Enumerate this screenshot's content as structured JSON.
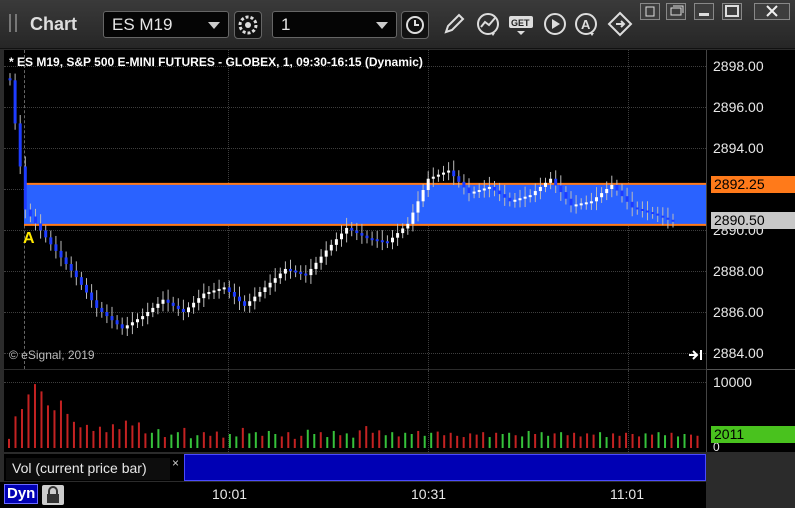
{
  "window": {
    "title": "Chart",
    "symbol": "ES M19",
    "interval": "1"
  },
  "chart": {
    "header": "* ES M19, S&P 500 E-MINI FUTURES - GLOBEX, 1, 09:30-16:15 (Dynamic)",
    "copyright": "© eSignal, 2019",
    "marker": "A",
    "price_ticks": [
      "2898.00",
      "2896.00",
      "2894.00",
      "2892.00",
      "2890.00",
      "2888.00",
      "2886.00",
      "2884.00"
    ],
    "upper_line": "2892.25",
    "last_price": "2890.50",
    "hidden_label": "2890.00",
    "volume_ticks": [
      "10000",
      "0"
    ],
    "volume_value": "2011",
    "volume_label": "Vol (current price bar)",
    "volume_close": "×",
    "time_labels": [
      "10:01",
      "10:31",
      "11:01"
    ],
    "layout_button": "Dyn",
    "colors": {
      "range": "#2a62ff",
      "orange_line": "#ff7a1a",
      "up_bar": "#ffffff",
      "down_bar": "#1e3cff",
      "vol_up": "#36c23b",
      "vol_down": "#c42222",
      "last_vol_tag": "#49c21e"
    }
  },
  "chart_data": {
    "type": "candlestick",
    "title": "* ES M19, S&P 500 E-MINI FUTURES - GLOBEX, 1, 09:30-16:15 (Dynamic)",
    "ylim": [
      2883.5,
      2899.0
    ],
    "y_ticks": [
      2884,
      2886,
      2888,
      2890,
      2892,
      2894,
      2896,
      2898
    ],
    "x_ticks": [
      "10:01",
      "10:31",
      "11:01"
    ],
    "range_band": [
      2890.25,
      2892.25
    ],
    "last_price": 2890.5,
    "close_path": [
      [
        0,
        2897.3
      ],
      [
        3,
        2891.0
      ],
      [
        8,
        2889.3
      ],
      [
        13,
        2887.7
      ],
      [
        17,
        2886.2
      ],
      [
        22,
        2885.2
      ],
      [
        26,
        2885.8
      ],
      [
        30,
        2886.6
      ],
      [
        34,
        2886.0
      ],
      [
        38,
        2886.9
      ],
      [
        42,
        2887.2
      ],
      [
        46,
        2886.3
      ],
      [
        50,
        2887.2
      ],
      [
        54,
        2888.1
      ],
      [
        58,
        2887.8
      ],
      [
        62,
        2889.0
      ],
      [
        66,
        2890.1
      ],
      [
        70,
        2889.6
      ],
      [
        74,
        2889.4
      ],
      [
        78,
        2890.3
      ],
      [
        82,
        2892.5
      ],
      [
        86,
        2892.9
      ],
      [
        90,
        2891.8
      ],
      [
        94,
        2892.1
      ],
      [
        98,
        2891.4
      ],
      [
        102,
        2891.7
      ],
      [
        106,
        2892.5
      ],
      [
        110,
        2891.2
      ],
      [
        114,
        2891.4
      ],
      [
        118,
        2892.2
      ],
      [
        122,
        2891.1
      ],
      [
        126,
        2890.8
      ],
      [
        130,
        2890.4
      ]
    ],
    "volume": {
      "ylim": [
        0,
        11500
      ],
      "values": [
        1500,
        5200,
        6400,
        8800,
        10500,
        9300,
        7000,
        6200,
        7800,
        5600,
        4300,
        3400,
        3800,
        2800,
        3500,
        2600,
        3900,
        3100,
        4500,
        3700,
        4200,
        2400,
        2500,
        3100,
        1800,
        2200,
        2600,
        3300,
        1600,
        2100,
        2600,
        2000,
        2700,
        1700,
        2300,
        1900,
        3300,
        2400,
        2600,
        2000,
        2800,
        2300,
        1900,
        2600,
        1500,
        2000,
        3000,
        2300,
        2600,
        1800,
        2800,
        2100,
        2400,
        1700,
        2900,
        3600,
        2500,
        2900,
        2100,
        2600,
        1900,
        2500,
        2300,
        2800,
        2000,
        2500,
        2700,
        2100,
        2500,
        2000,
        1800,
        2400,
        2200,
        2600,
        1800,
        2500,
        2300,
        2500,
        2100,
        1900,
        2800,
        2300,
        2600,
        2000,
        2400,
        2600,
        2100,
        2500,
        1900,
        2400,
        2200,
        2600,
        1800,
        2400,
        2000,
        2500,
        2300,
        1900,
        2400,
        2200,
        2600,
        2100,
        2500,
        1900,
        2300,
        2200,
        2011
      ],
      "last": 2011
    }
  }
}
